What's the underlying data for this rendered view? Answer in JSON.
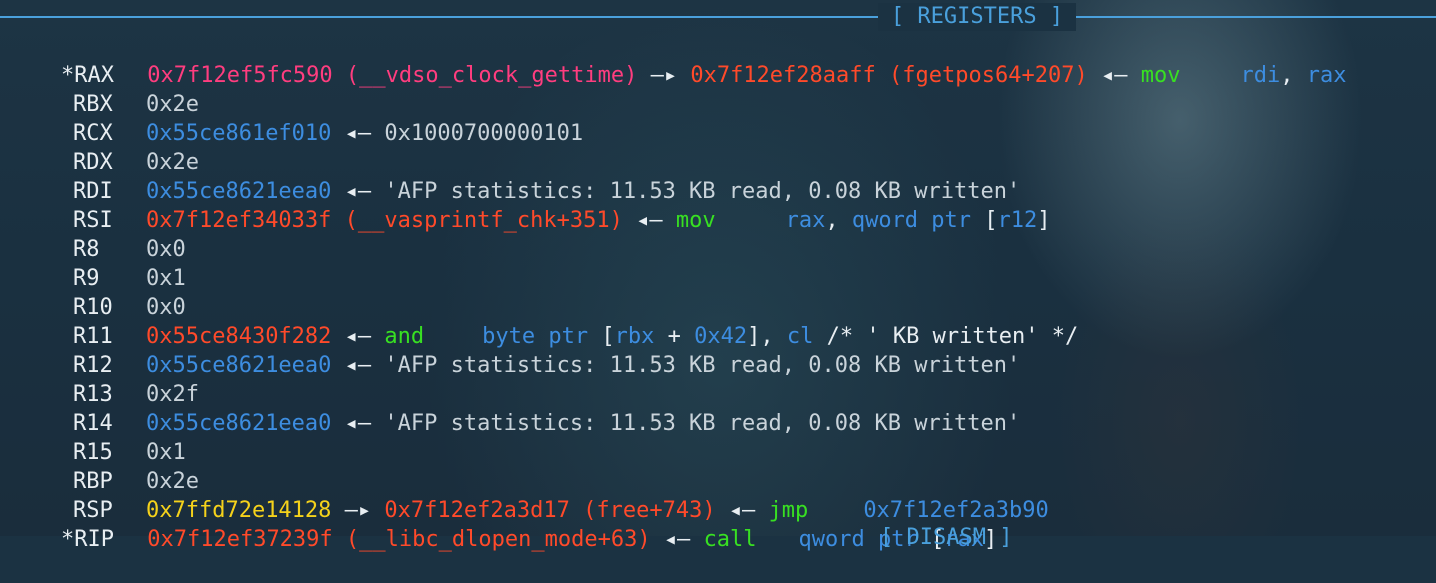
{
  "header": {
    "title": "[ REGISTERS ]",
    "bottom_header": "[ DISASM ]"
  },
  "registers": {
    "rax": {
      "marker": "*",
      "name": "RAX",
      "value": "0x7f12ef5fc590",
      "sym1": "(__vdso_clock_gettime)",
      "arrow": "—▸",
      "ptr": "0x7f12ef28aaff",
      "sym2": "(fgetpos64+207)",
      "arrow2": "◂—",
      "op": "mov",
      "arg1": "rdi",
      "comma": ",",
      "arg2": "rax"
    },
    "rbx": {
      "name": "RBX",
      "value": "0x2e"
    },
    "rcx": {
      "name": "RCX",
      "value": "0x55ce861ef010",
      "arrow": "◂—",
      "target": "0x1000700000101"
    },
    "rdx": {
      "name": "RDX",
      "value": "0x2e"
    },
    "rdi": {
      "name": "RDI",
      "value": "0x55ce8621eea0",
      "arrow": "◂—",
      "target": "'AFP statistics: 11.53 KB read, 0.08 KB written'"
    },
    "rsi": {
      "name": "RSI",
      "value": "0x7f12ef34033f",
      "sym": "(__vasprintf_chk+351)",
      "arrow": "◂—",
      "op": "mov",
      "arg1": "rax",
      "comma": ",",
      "arg2": "qword ptr",
      "lb": "[",
      "arg3": "r12",
      "rb": "]"
    },
    "r8": {
      "name": "R8",
      "value": "0x0"
    },
    "r9": {
      "name": "R9",
      "value": "0x1"
    },
    "r10": {
      "name": "R10",
      "value": "0x0"
    },
    "r11": {
      "name": "R11",
      "value": "0x55ce8430f282",
      "arrow": "◂—",
      "op": "and",
      "arg1": "byte ptr",
      "lb": "[",
      "arg2": "rbx",
      "plus": "+",
      "arg3": "0x42",
      "rb": "],",
      "arg4": "cl",
      "comment": "/* ' KB written' */"
    },
    "r12": {
      "name": "R12",
      "value": "0x55ce8621eea0",
      "arrow": "◂—",
      "target": "'AFP statistics: 11.53 KB read, 0.08 KB written'"
    },
    "r13": {
      "name": "R13",
      "value": "0x2f"
    },
    "r14": {
      "name": "R14",
      "value": "0x55ce8621eea0",
      "arrow": "◂—",
      "target": "'AFP statistics: 11.53 KB read, 0.08 KB written'"
    },
    "r15": {
      "name": "R15",
      "value": "0x1"
    },
    "rbp": {
      "name": "RBP",
      "value": "0x2e"
    },
    "rsp": {
      "name": "RSP",
      "value": "0x7ffd72e14128",
      "arrow": "—▸",
      "ptr": "0x7f12ef2a3d17",
      "sym": "(free+743)",
      "arrow2": "◂—",
      "op": "jmp",
      "arg1": "0x7f12ef2a3b90"
    },
    "rip": {
      "marker": "*",
      "name": "RIP",
      "value": "0x7f12ef37239f",
      "sym": "(__libc_dlopen_mode+63)",
      "arrow": "◂—",
      "op": "call",
      "arg1": "qword ptr",
      "lb": "[",
      "arg2": "rax",
      "rb": "]"
    }
  },
  "colors": {
    "background": "#1b3242",
    "accent_blue": "#3d8de0",
    "symbol_red": "#ff4a2a",
    "vdso_pink": "#ff3d7f",
    "opcode_green": "#38e022",
    "stack_yellow": "#f5d21b"
  }
}
